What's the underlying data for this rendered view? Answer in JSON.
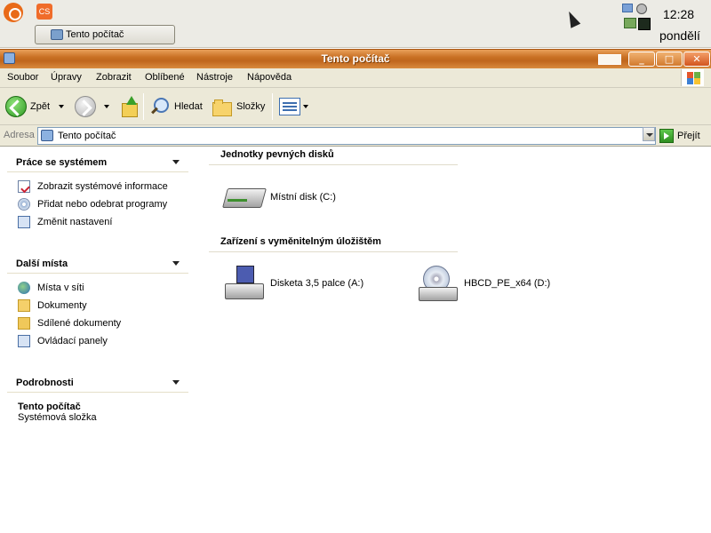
{
  "panel": {
    "cs_label": "CS",
    "task_label": "Tento počítač",
    "clock": "12:28",
    "day": "pondělí"
  },
  "window": {
    "title": "Tento počítač"
  },
  "menu": [
    "Soubor",
    "Úpravy",
    "Zobrazit",
    "Oblíbené",
    "Nástroje",
    "Nápověda"
  ],
  "toolbar": {
    "back": "Zpět",
    "search": "Hledat",
    "folders": "Složky"
  },
  "address": {
    "label": "Adresa",
    "value": "Tento počítač",
    "go": "Přejít"
  },
  "sidebar": {
    "system_tasks": {
      "title": "Práce se systémem",
      "items": [
        "Zobrazit systémové informace",
        "Přidat nebo odebrat programy",
        "Změnit nastavení"
      ]
    },
    "other_places": {
      "title": "Další místa",
      "items": [
        "Místa v síti",
        "Dokumenty",
        "Sdílené dokumenty",
        "Ovládací panely"
      ]
    },
    "details": {
      "title": "Podrobnosti",
      "name": "Tento počítač",
      "type": "Systémová složka"
    }
  },
  "content": {
    "hard_disks": {
      "title": "Jednotky pevných disků",
      "drives": [
        "Místní disk (C:)"
      ]
    },
    "removable": {
      "title": "Zařízení s vyměnitelným úložištěm",
      "drives": [
        "Disketa 3,5 palce (A:)",
        "HBCD_PE_x64 (D:)"
      ]
    }
  },
  "colors": {
    "titlebar": "#c87024",
    "chrome": "#ece9d8"
  }
}
